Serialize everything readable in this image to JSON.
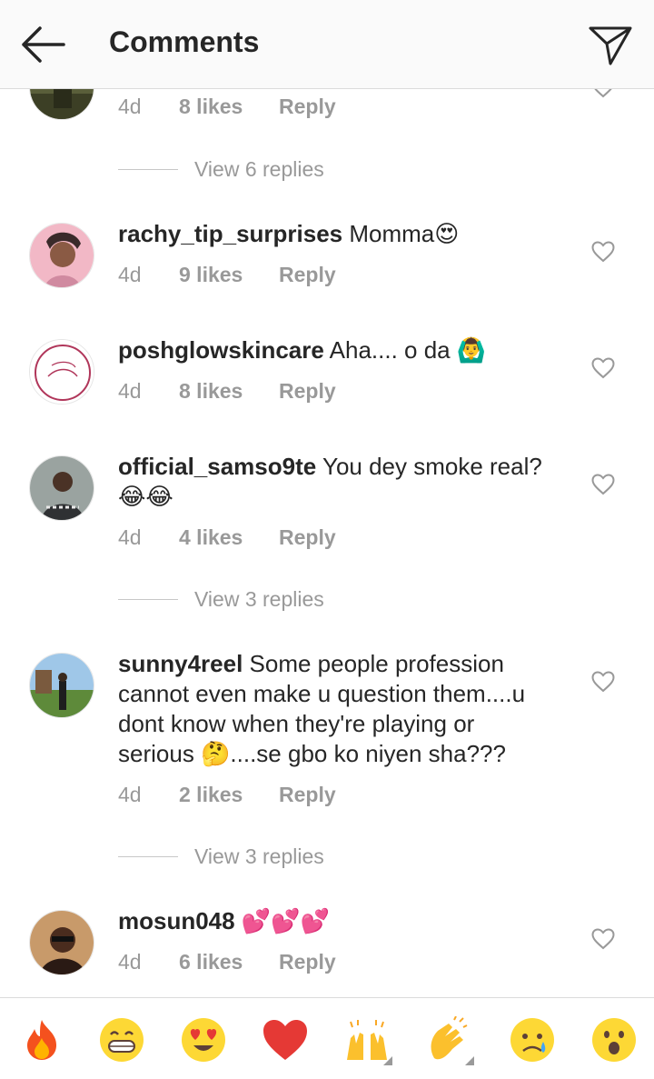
{
  "header": {
    "title": "Comments"
  },
  "comments": [
    {
      "user": "",
      "text": "",
      "time": "4d",
      "likes": "8 likes",
      "reply": "Reply"
    },
    {
      "user": "rachy_tip_surprises",
      "text": "Momma😍",
      "time": "4d",
      "likes": "9 likes",
      "reply": "Reply"
    },
    {
      "user": "poshglowskincare",
      "text": "Aha.... o da 🙆‍♂️",
      "time": "4d",
      "likes": "8 likes",
      "reply": "Reply"
    },
    {
      "user": "official_samso9te",
      "text": "You dey smoke real?",
      "text2": "😂😂",
      "time": "4d",
      "likes": "4 likes",
      "reply": "Reply"
    },
    {
      "user": "sunny4reel",
      "text": "Some people profession",
      "text2": "cannot even make u question them....u",
      "text3": "dont know when they're playing or",
      "text4": "serious 🤔....se gbo ko niyen sha???",
      "time": "4d",
      "likes": "2 likes",
      "reply": "Reply"
    },
    {
      "user": "mosun048",
      "text": "💕💕💕",
      "time": "4d",
      "likes": "6 likes",
      "reply": "Reply"
    }
  ],
  "view_replies": [
    "View 6 replies",
    "View 3 replies",
    "View 3 replies"
  ],
  "emoji_bar": [
    "🔥",
    "😁",
    "😍",
    "❤️",
    "🙌",
    "👏",
    "😢",
    "😮"
  ],
  "colors": {
    "muted": "#999999",
    "text": "#262626",
    "divider": "#dbdbdb",
    "header_bg": "#fafafa"
  },
  "icons": {
    "back": "arrow-left-icon",
    "send": "paper-plane-icon",
    "like": "heart-outline-icon"
  }
}
